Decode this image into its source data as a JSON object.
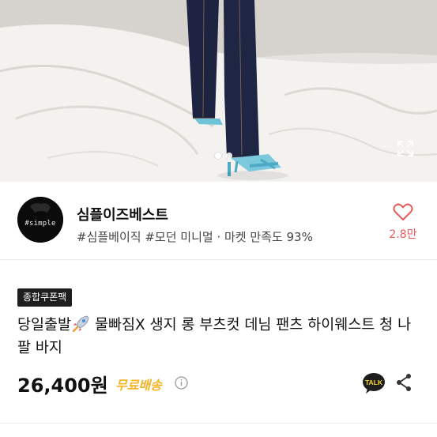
{
  "gallery": {
    "image_alt": "product-photo-flare-denim-pants",
    "page_count": 2,
    "active_index": 0,
    "expand_icon": "expand-icon"
  },
  "seller": {
    "avatar_text": "#simple",
    "name": "심플이즈베스트",
    "tags": "#심플베이직 #모던 미니멀 · 마켓 만족도 93%",
    "likes": "2.8만",
    "like_icon": "heart-icon"
  },
  "product": {
    "badge": "종합쿠폰팩",
    "title_prefix": "당일출발",
    "title_icon": "rocket-icon",
    "title_rest": " 물빠짐X 생지 롱 부츠컷 데님 팬츠 하이웨스트 청 나팔 바지",
    "price": "26,400원",
    "shipping": "무료배송",
    "talk_label": "TALK",
    "share_icon": "share-icon"
  },
  "colors": {
    "accent_shipping": "#f5b428",
    "like": "#e85b5b",
    "talk_bubble": "#1e1e1e"
  }
}
